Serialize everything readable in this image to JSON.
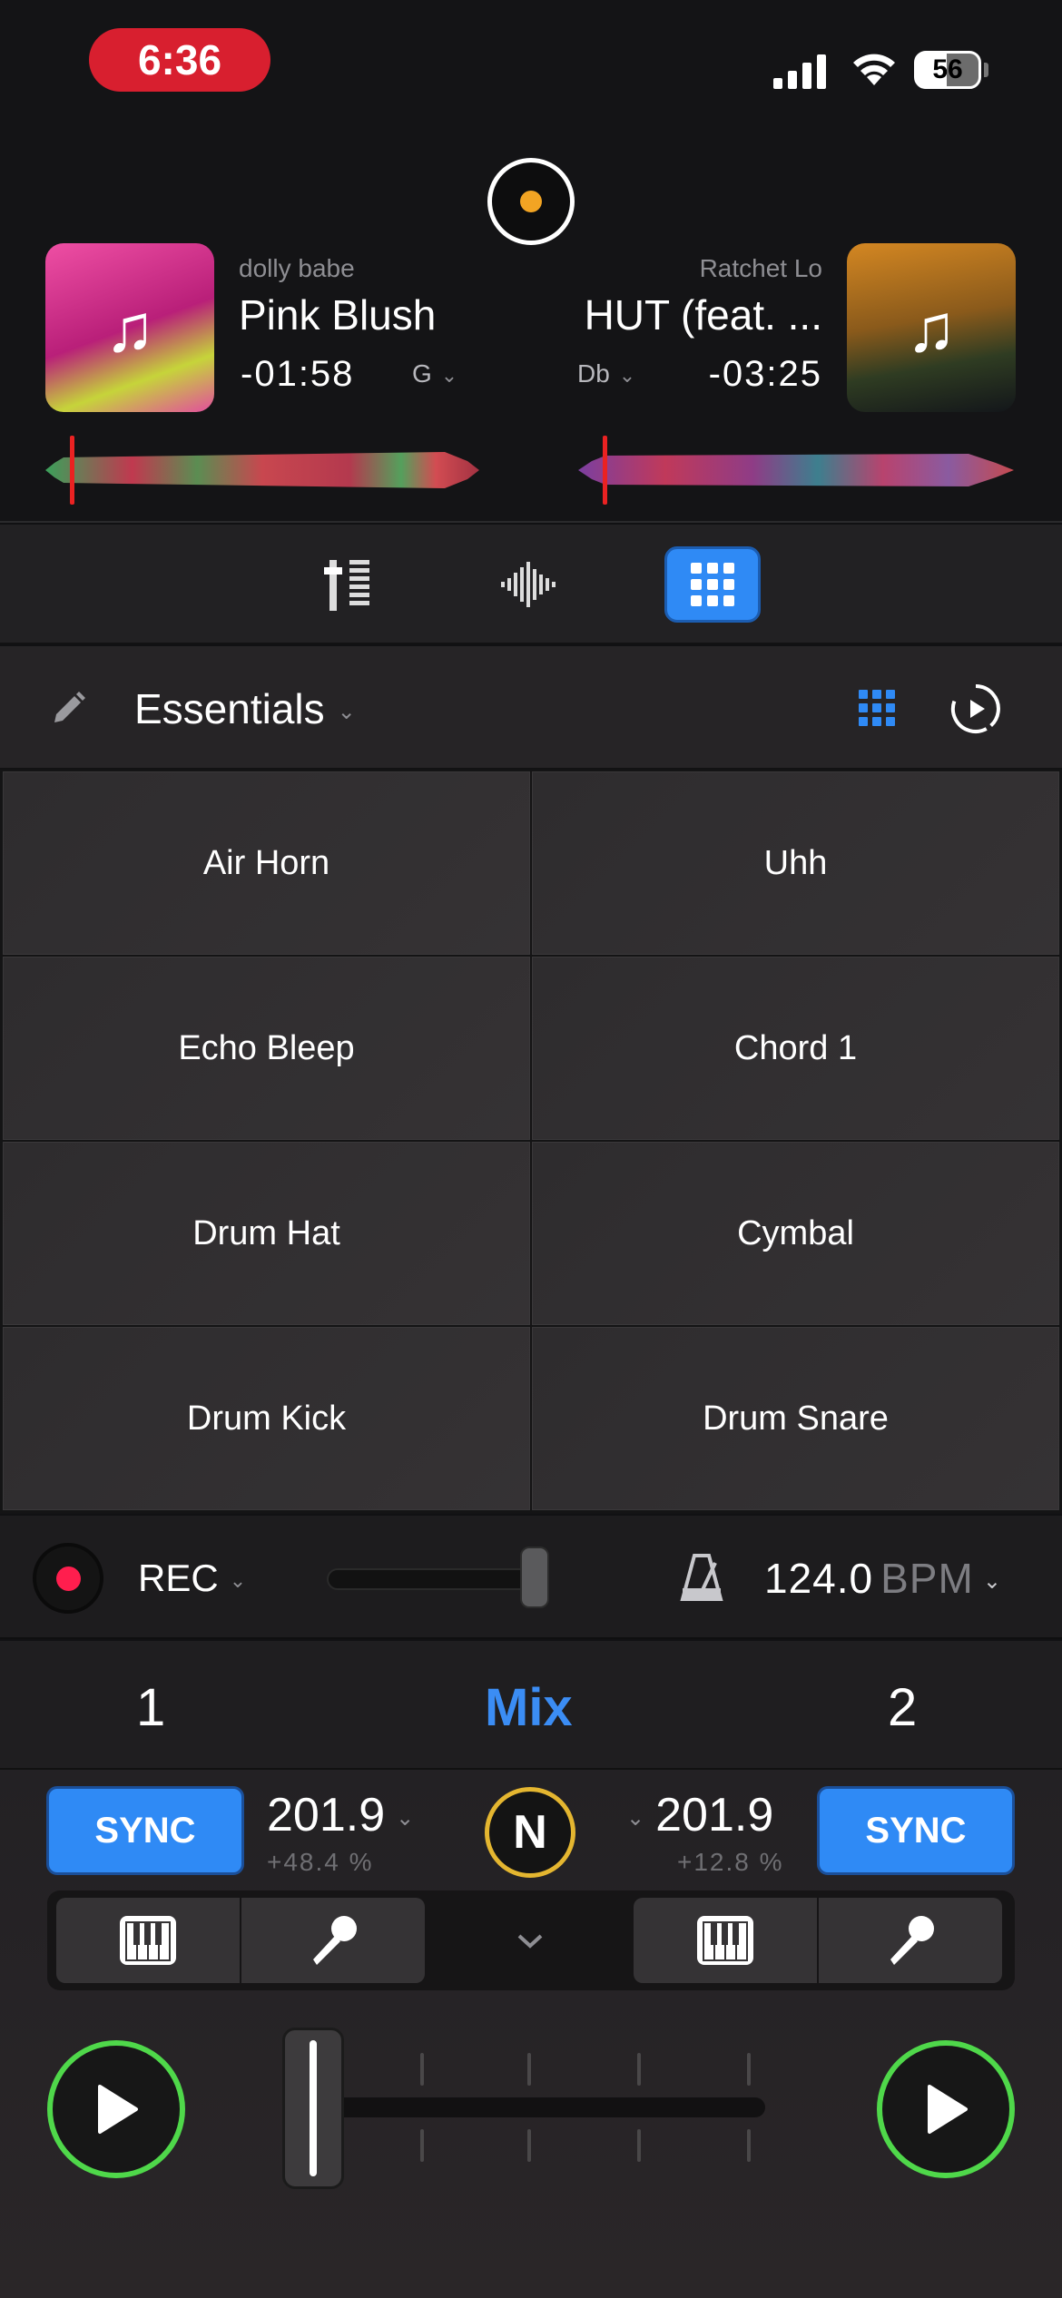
{
  "status": {
    "time": "6:36",
    "battery": "56"
  },
  "decks": {
    "left": {
      "artist": "dolly babe",
      "title": "Pink Blush",
      "remaining": "-01:58",
      "key": "G",
      "cover_icon": "music-note-icon"
    },
    "right": {
      "artist": "Ratchet Lo",
      "title": "HUT (feat. ...",
      "remaining": "-03:25",
      "key": "Db",
      "cover_icon": "music-note-icon"
    }
  },
  "mode_toolbar": {
    "buttons": [
      "mixer-icon",
      "waveform-icon",
      "sampler-grid-icon"
    ],
    "active": "sampler-grid-icon",
    "accent": "#2f8af5"
  },
  "sampler": {
    "pack_name": "Essentials",
    "pads": [
      "Air Horn",
      "Uhh",
      "Echo Bleep",
      "Chord 1",
      "Drum Hat",
      "Cymbal",
      "Drum Kick",
      "Drum Snare"
    ]
  },
  "record_bar": {
    "rec_label": "REC",
    "bpm_value": "124.0",
    "bpm_unit": "BPM"
  },
  "deck_select": {
    "left": "1",
    "center": "Mix",
    "right": "2",
    "center_color": "#3b8df4"
  },
  "controls": {
    "sync_label": "SYNC",
    "left_tempo": "201.9",
    "left_pitch": "+48.4 %",
    "right_tempo": "201.9",
    "right_pitch": "+12.8 %",
    "center_badge": "N",
    "play_color": "#4fd84a"
  }
}
